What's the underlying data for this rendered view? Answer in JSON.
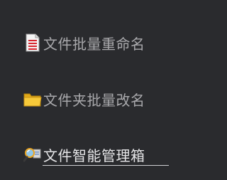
{
  "menu": {
    "items": [
      {
        "label": "文件批量重命名",
        "icon": "document-list-icon",
        "selected": false
      },
      {
        "label": "文件夹批量改名",
        "icon": "folder-icon",
        "selected": false
      },
      {
        "label": "文件智能管理箱",
        "icon": "magnifier-tool-icon",
        "selected": true
      }
    ]
  },
  "colors": {
    "background": "#2a2b2e",
    "text": "#a9a9ac",
    "text_selected": "#e6e6e8",
    "document_red": "#d7262e",
    "folder_yellow": "#f2c12e"
  }
}
